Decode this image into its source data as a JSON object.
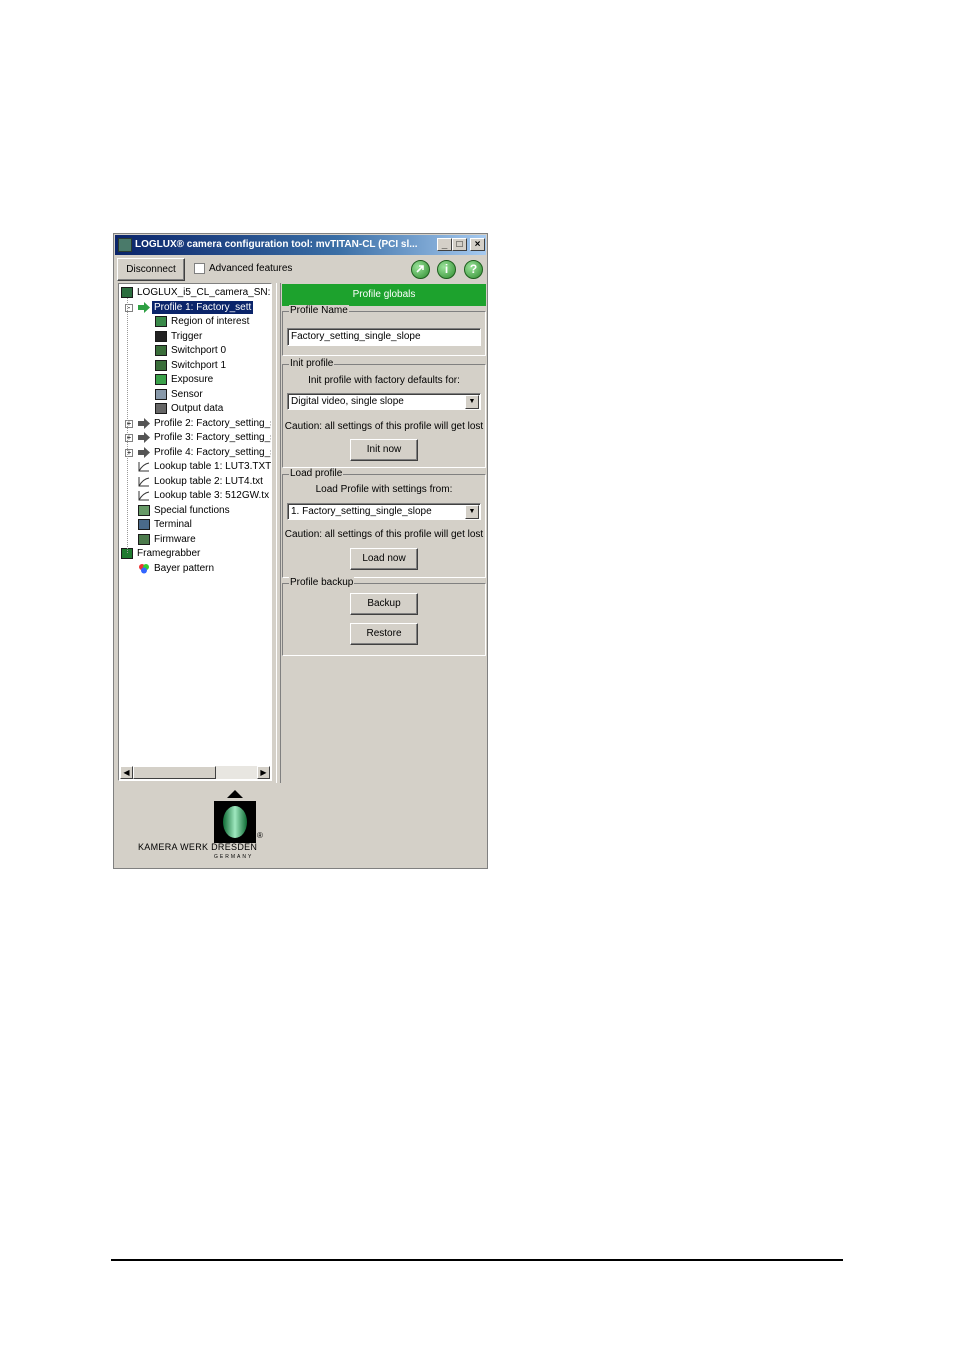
{
  "window": {
    "title": "LOGLUX® camera configuration tool: mvTITAN-CL (PCI sl...",
    "buttons": {
      "minimize": "_",
      "maximize": "□",
      "close": "×"
    }
  },
  "toolbar": {
    "disconnect_label": "Disconnect",
    "advanced_label": "Advanced features",
    "advanced_checked": false,
    "icons": [
      "refresh-icon",
      "info-icon",
      "help-icon"
    ],
    "info_glyph": "i",
    "help_glyph": "?"
  },
  "tree": {
    "items": [
      {
        "label": "LOGLUX_i5_CL_camera_SN:",
        "icon": "camera-icon",
        "level": 0
      },
      {
        "label": "Profile 1: Factory_sett",
        "icon": "arrow-icon",
        "level": 1,
        "selected": true,
        "expander": "-"
      },
      {
        "label": "Region of interest",
        "icon": "roi-icon",
        "level": 2
      },
      {
        "label": "Trigger",
        "icon": "trigger-icon",
        "level": 2
      },
      {
        "label": "Switchport 0",
        "icon": "switchport-icon",
        "level": 2
      },
      {
        "label": "Switchport 1",
        "icon": "switchport-icon",
        "level": 2
      },
      {
        "label": "Exposure",
        "icon": "exposure-icon",
        "level": 2
      },
      {
        "label": "Sensor",
        "icon": "sensor-icon",
        "level": 2
      },
      {
        "label": "Output data",
        "icon": "output-icon",
        "level": 2
      },
      {
        "label": "Profile 2: Factory_setting_s",
        "icon": "arrow-icon",
        "level": 1,
        "expander": "+"
      },
      {
        "label": "Profile 3: Factory_setting_s",
        "icon": "arrow-icon",
        "level": 1,
        "expander": "+"
      },
      {
        "label": "Profile 4: Factory_setting_s",
        "icon": "arrow-icon",
        "level": 1,
        "expander": "+"
      },
      {
        "label": "Lookup table 1: LUT3.TXT",
        "icon": "lut-icon",
        "level": 1
      },
      {
        "label": "Lookup table 2: LUT4.txt",
        "icon": "lut-icon",
        "level": 1
      },
      {
        "label": "Lookup table 3: 512GW.tx",
        "icon": "lut-icon",
        "level": 1
      },
      {
        "label": "Special functions",
        "icon": "special-icon",
        "level": 1
      },
      {
        "label": "Terminal",
        "icon": "terminal-icon",
        "level": 1
      },
      {
        "label": "Firmware",
        "icon": "firmware-icon",
        "level": 1
      },
      {
        "label": "Framegrabber",
        "icon": "framegrabber-icon",
        "level": 0
      },
      {
        "label": "Bayer pattern",
        "icon": "bayer-icon",
        "level": 1
      }
    ]
  },
  "panel": {
    "header": "Profile globals",
    "profile_name": {
      "group": "Profile Name",
      "value": "Factory_setting_single_slope"
    },
    "init_profile": {
      "group": "Init profile",
      "description": "Init profile with factory defaults for:",
      "selected": "Digital video, single slope",
      "caution": "Caution: all settings of this profile will get lost",
      "button": "Init now"
    },
    "load_profile": {
      "group": "Load profile",
      "description": "Load Profile with settings from:",
      "selected": "1. Factory_setting_single_slope",
      "caution": "Caution: all settings of this profile will get lost",
      "button": "Load now"
    },
    "profile_backup": {
      "group": "Profile backup",
      "backup_button": "Backup",
      "restore_button": "Restore"
    }
  },
  "logo": {
    "text": "KAMERA WERK DRESDEN",
    "subtext": "GERMANY",
    "registered": "®"
  },
  "colors": {
    "header_green": "#1da22d",
    "title_blue": "#0a246a",
    "window_bg": "#d4d0c8"
  }
}
